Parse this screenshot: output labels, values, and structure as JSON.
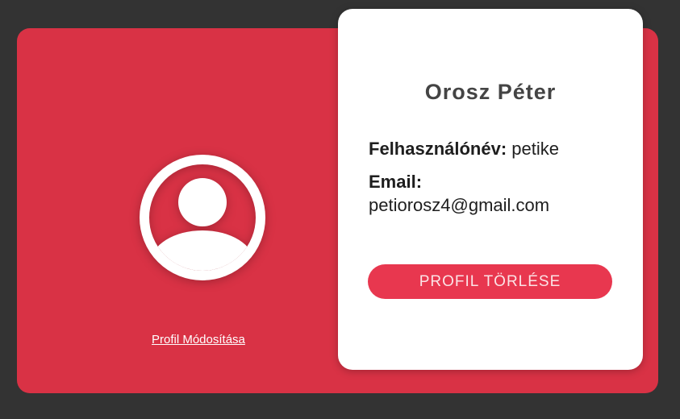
{
  "profile": {
    "full_name": "Orosz Péter",
    "username_label": "Felhasználónév:",
    "username_value": "petike",
    "email_label": "Email:",
    "email_value": "petiorosz4@gmail.com",
    "avatar_icon": "user-avatar-icon"
  },
  "actions": {
    "edit_profile_label": "Profil Módosítása",
    "delete_profile_label": "PROFIL TÖRLÉSE"
  },
  "colors": {
    "page_background": "#333333",
    "card_red": "#d93245",
    "button_red": "#e8374f",
    "card_white": "#ffffff"
  }
}
